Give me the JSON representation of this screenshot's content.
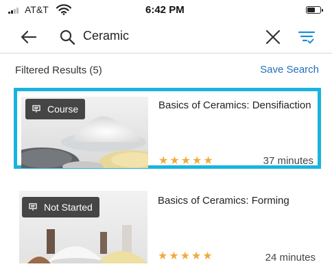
{
  "status_bar": {
    "carrier": "AT&T",
    "time": "6:42 PM",
    "icons": [
      "signal-icon",
      "wifi-icon",
      "battery-icon"
    ]
  },
  "search": {
    "query": "Ceramic",
    "icons": [
      "back-arrow-icon",
      "search-icon",
      "close-icon",
      "filter-icon"
    ]
  },
  "results": {
    "header": "Filtered Results (5)",
    "save_search_label": "Save Search"
  },
  "colors": {
    "accent": "#1d6fb8",
    "selection_border": "#18b4df",
    "filter_icon": "#1a8fd6",
    "star": "#f4a93b"
  },
  "items": [
    {
      "badge": "Course",
      "title": "Basics of Ceramics: Densifiaction",
      "rating_stars": "★★★★★",
      "rating_value": 5,
      "duration": "37 minutes",
      "selected": true
    },
    {
      "badge": "Not Started",
      "title": "Basics of Ceramics: Forming",
      "rating_stars": "★★★★★",
      "rating_value": 5,
      "duration": "24 minutes",
      "selected": false
    }
  ]
}
